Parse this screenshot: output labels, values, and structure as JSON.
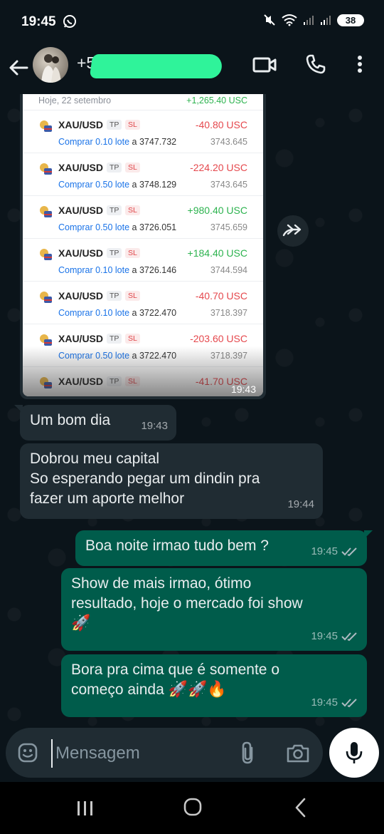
{
  "status_bar": {
    "time": "19:45",
    "battery": "38"
  },
  "header": {
    "contact_prefix": "+5",
    "back_icon": "arrow-left-icon",
    "video_icon": "video-camera-icon",
    "call_icon": "phone-icon",
    "menu_icon": "more-vertical-icon"
  },
  "image_message": {
    "time": "19:43",
    "screenshot": {
      "date": "Hoje, 22 setembro",
      "total": "+1,265.40 USC",
      "trades": [
        {
          "symbol": "XAU/USD",
          "tp": "TP",
          "sl": "SL",
          "profit": "-40.80 USC",
          "sign": "neg",
          "action": "Comprar 0.10 lote",
          "open": "a 3747.732",
          "current": "3743.645"
        },
        {
          "symbol": "XAU/USD",
          "tp": "TP",
          "sl": "SL",
          "profit": "-224.20 USC",
          "sign": "neg",
          "action": "Comprar 0.50 lote",
          "open": "a 3748.129",
          "current": "3743.645"
        },
        {
          "symbol": "XAU/USD",
          "tp": "TP",
          "sl": "SL",
          "profit": "+980.40 USC",
          "sign": "pos",
          "action": "Comprar 0.50 lote",
          "open": "a 3726.051",
          "current": "3745.659"
        },
        {
          "symbol": "XAU/USD",
          "tp": "TP",
          "sl": "SL",
          "profit": "+184.40 USC",
          "sign": "pos",
          "action": "Comprar 0.10 lote",
          "open": "a 3726.146",
          "current": "3744.594"
        },
        {
          "symbol": "XAU/USD",
          "tp": "TP",
          "sl": "SL",
          "profit": "-40.70 USC",
          "sign": "neg",
          "action": "Comprar 0.10 lote",
          "open": "a 3722.470",
          "current": "3718.397"
        },
        {
          "symbol": "XAU/USD",
          "tp": "TP",
          "sl": "SL",
          "profit": "-203.60 USC",
          "sign": "neg",
          "action": "Comprar 0.50 lote",
          "open": "a 3722.470",
          "current": "3718.397"
        },
        {
          "symbol": "XAU/USD",
          "tp": "TP",
          "sl": "SL",
          "profit": "-41.70 USC",
          "sign": "neg",
          "action": "",
          "open": "",
          "current": ""
        }
      ]
    }
  },
  "messages": [
    {
      "direction": "in",
      "lines": [
        "Um bom dia"
      ],
      "time": "19:43"
    },
    {
      "direction": "in",
      "lines": [
        "Dobrou meu capital",
        "So esperando pegar um dindin pra",
        "fazer um aporte melhor"
      ],
      "time": "19:44"
    },
    {
      "direction": "out",
      "lines": [
        "Boa noite irmao tudo bem ?"
      ],
      "time": "19:45"
    },
    {
      "direction": "out",
      "lines": [
        "Show de mais irmao, ótimo",
        "resultado, hoje o mercado foi show"
      ],
      "emoji": "🚀",
      "time": "19:45"
    },
    {
      "direction": "out",
      "lines": [
        "Bora pra cima que é somente o",
        "começo ainda"
      ],
      "emoji": "🚀🚀🔥",
      "time": "19:45"
    }
  ],
  "input": {
    "placeholder": "Mensagem"
  },
  "colors": {
    "background": "#0b141a",
    "incoming": "#202c33",
    "outgoing": "#005c4b",
    "redaction": "#2ff39a",
    "profit_positive": "#2db34f",
    "profit_negative": "#e5484d"
  }
}
